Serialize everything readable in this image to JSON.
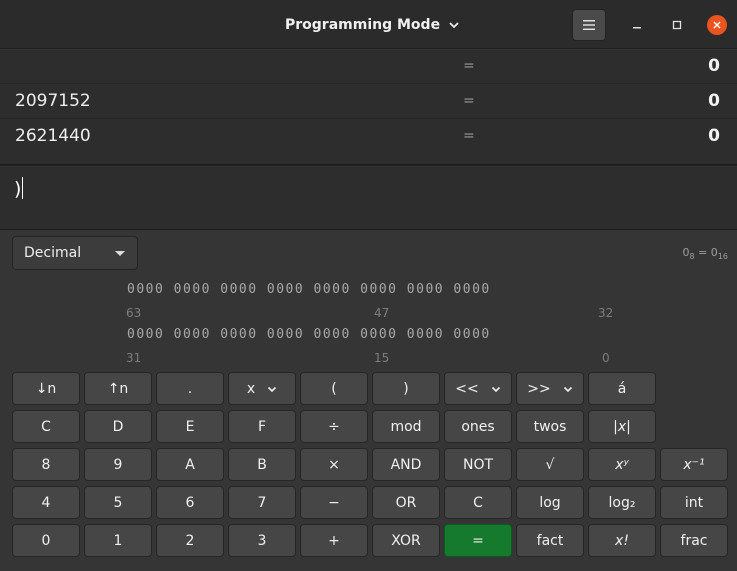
{
  "header": {
    "title": "Programming Mode",
    "menu_icon": "hamburger-menu-icon",
    "minimize_icon": "minimize-icon",
    "maximize_icon": "maximize-icon",
    "close_icon": "close-icon",
    "close_color": "#e95420"
  },
  "history": [
    {
      "expr": "",
      "eq": "=",
      "result": "0"
    },
    {
      "expr": "2097152",
      "eq": "=",
      "result": "0"
    },
    {
      "expr": "2621440",
      "eq": "=",
      "result": "0"
    }
  ],
  "input": {
    "value": ")"
  },
  "base": {
    "selected": "Decimal"
  },
  "conversion": {
    "left": "0",
    "left_sub": "8",
    "mid": " = 0",
    "right_sub": "16"
  },
  "bits": {
    "row1": "0000 0000 0000 0000 0000 0000 0000 0000",
    "row2": "0000 0000 0000 0000 0000 0000 0000 0000",
    "labels_row1": [
      "63",
      "47",
      "32"
    ],
    "labels_row2": [
      "31",
      "15",
      "0"
    ]
  },
  "buttons": {
    "row1": [
      "↓n",
      "↑n",
      ".",
      "x",
      "(",
      ")",
      "<<",
      ">>",
      "á"
    ],
    "row2": [
      "C",
      "D",
      "E",
      "F",
      "÷",
      "mod",
      "ones",
      "twos",
      "|x|"
    ],
    "row3": [
      "8",
      "9",
      "A",
      "B",
      "×",
      "AND",
      "NOT",
      "√",
      "xʸ",
      "x⁻¹"
    ],
    "row4": [
      "4",
      "5",
      "6",
      "7",
      "−",
      "OR",
      "C",
      "log",
      "log₂",
      "int"
    ],
    "row5": [
      "0",
      "1",
      "2",
      "3",
      "+",
      "XOR",
      "=",
      "fact",
      "x!",
      "frac"
    ]
  },
  "colors": {
    "equals_button": "#157a2d",
    "background": "#353535"
  }
}
